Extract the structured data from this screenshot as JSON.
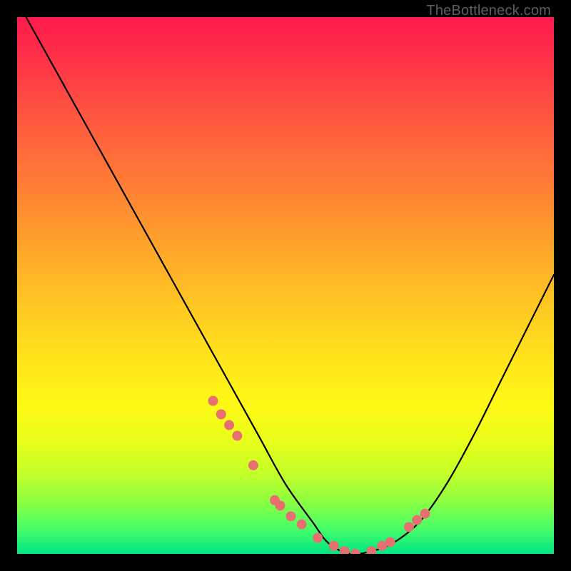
{
  "watermark": "TheBottleneck.com",
  "chart_data": {
    "type": "line",
    "title": "",
    "xlabel": "",
    "ylabel": "",
    "xlim": [
      0,
      100
    ],
    "ylim": [
      0,
      100
    ],
    "series": [
      {
        "name": "bottleneck-curve",
        "x": [
          0,
          5,
          10,
          15,
          20,
          25,
          30,
          35,
          40,
          45,
          50,
          55,
          58,
          62,
          66,
          70,
          75,
          80,
          85,
          90,
          95,
          100
        ],
        "values": [
          103,
          94,
          85,
          76,
          67,
          58,
          49,
          40,
          31,
          22,
          13,
          6,
          2,
          0,
          0.5,
          2,
          6,
          13,
          22,
          32,
          42,
          52
        ]
      }
    ],
    "markers": {
      "name": "sample-dots",
      "x": [
        36.5,
        38,
        39.5,
        41,
        44,
        48,
        49,
        51,
        53,
        56,
        59,
        61,
        63,
        66,
        68,
        69.5,
        73,
        74.5,
        76
      ],
      "values": [
        28.5,
        26,
        24,
        22,
        16.5,
        10,
        9,
        7,
        5.5,
        3,
        1.5,
        0.5,
        0,
        0.5,
        1.5,
        2.2,
        5,
        6.3,
        7.5
      ],
      "color": "#e86f6f",
      "radius": 7
    },
    "colors": {
      "curve": "#000000",
      "background_top": "#ff1a4d",
      "background_bottom": "#00e682",
      "frame": "#000000"
    }
  }
}
